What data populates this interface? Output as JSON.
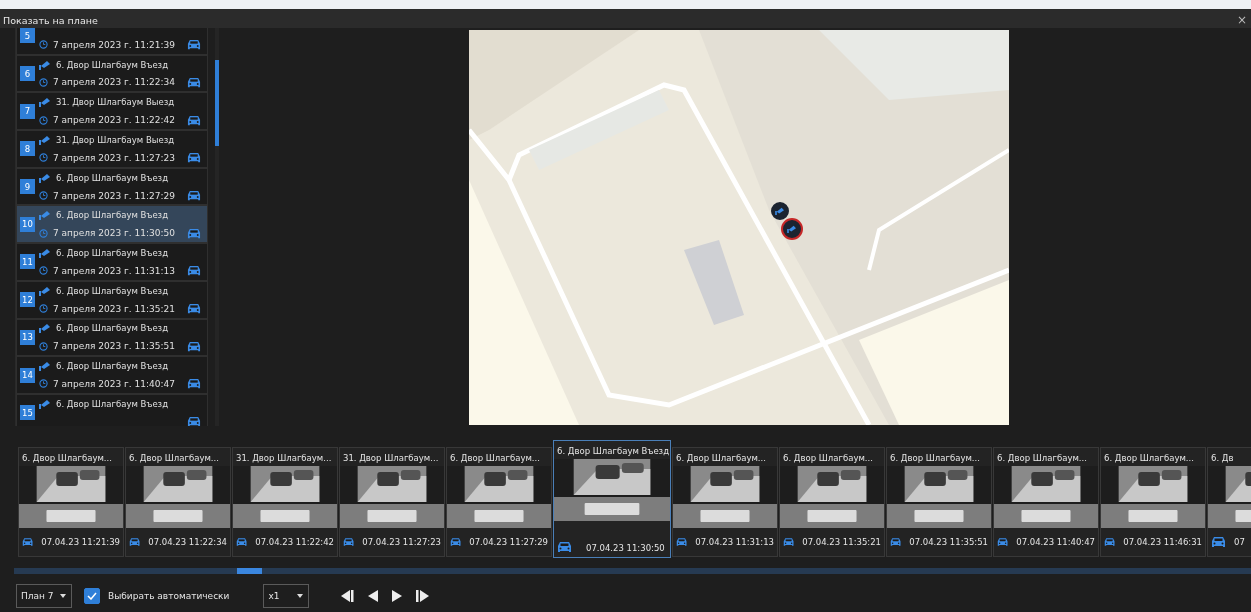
{
  "window": {
    "title": "Показать на плане",
    "close": "×"
  },
  "events": [
    {
      "number": "5",
      "time": "7 апреля 2023 г. 11:21:39",
      "selected": false
    },
    {
      "number": "6",
      "name": "6. Двор Шлагбаум Въезд",
      "time": "7 апреля 2023 г. 11:22:34",
      "selected": false
    },
    {
      "number": "7",
      "name": "31. Двор Шлагбаум Выезд",
      "time": "7 апреля 2023 г. 11:22:42",
      "selected": false
    },
    {
      "number": "8",
      "name": "31. Двор Шлагбаум Выезд",
      "time": "7 апреля 2023 г. 11:27:23",
      "selected": false
    },
    {
      "number": "9",
      "name": "6. Двор Шлагбаум Въезд",
      "time": "7 апреля 2023 г. 11:27:29",
      "selected": false
    },
    {
      "number": "10",
      "name": "6. Двор Шлагбаум Въезд",
      "time": "7 апреля 2023 г. 11:30:50",
      "selected": true
    },
    {
      "number": "11",
      "name": "6. Двор Шлагбаум Въезд",
      "time": "7 апреля 2023 г. 11:31:13",
      "selected": false
    },
    {
      "number": "12",
      "name": "6. Двор Шлагбаум Въезд",
      "time": "7 апреля 2023 г. 11:35:21",
      "selected": false
    },
    {
      "number": "13",
      "name": "6. Двор Шлагбаум Въезд",
      "time": "7 апреля 2023 г. 11:35:51",
      "selected": false
    },
    {
      "number": "14",
      "name": "6. Двор Шлагбаум Въезд",
      "time": "7 апреля 2023 г. 11:40:47",
      "selected": false
    },
    {
      "number": "15",
      "name": "6. Двор Шлагбаум Въезд",
      "selected": false
    }
  ],
  "map": {
    "markers": [
      {
        "selected": false
      },
      {
        "selected": true
      }
    ]
  },
  "thumbnails": [
    {
      "title": "6. Двор Шлагбаум...",
      "time": "07.04.23 11:21:39",
      "selected": false
    },
    {
      "title": "6. Двор Шлагбаум...",
      "time": "07.04.23 11:22:34",
      "selected": false
    },
    {
      "title": "31. Двор Шлагбаум...",
      "time": "07.04.23 11:22:42",
      "selected": false
    },
    {
      "title": "31. Двор Шлагбаум...",
      "time": "07.04.23 11:27:23",
      "selected": false
    },
    {
      "title": "6. Двор Шлагбаум...",
      "time": "07.04.23 11:27:29",
      "selected": false
    },
    {
      "title": "6. Двор Шлагбаум Въезд",
      "time": "07.04.23 11:30:50",
      "selected": true
    },
    {
      "title": "6. Двор Шлагбаум...",
      "time": "07.04.23 11:31:13",
      "selected": false
    },
    {
      "title": "6. Двор Шлагбаум...",
      "time": "07.04.23 11:35:21",
      "selected": false
    },
    {
      "title": "6. Двор Шлагбаум...",
      "time": "07.04.23 11:35:51",
      "selected": false
    },
    {
      "title": "6. Двор Шлагбаум...",
      "time": "07.04.23 11:40:47",
      "selected": false
    },
    {
      "title": "6. Двор Шлагбаум...",
      "time": "07.04.23 11:46:31",
      "selected": false
    },
    {
      "title": "6. Дв",
      "time": "07",
      "selected": false
    }
  ],
  "controls": {
    "plan": {
      "value": "План 7"
    },
    "auto_select": {
      "label": "Выбирать автоматически",
      "checked": true
    },
    "speed": {
      "value": "x1"
    }
  }
}
